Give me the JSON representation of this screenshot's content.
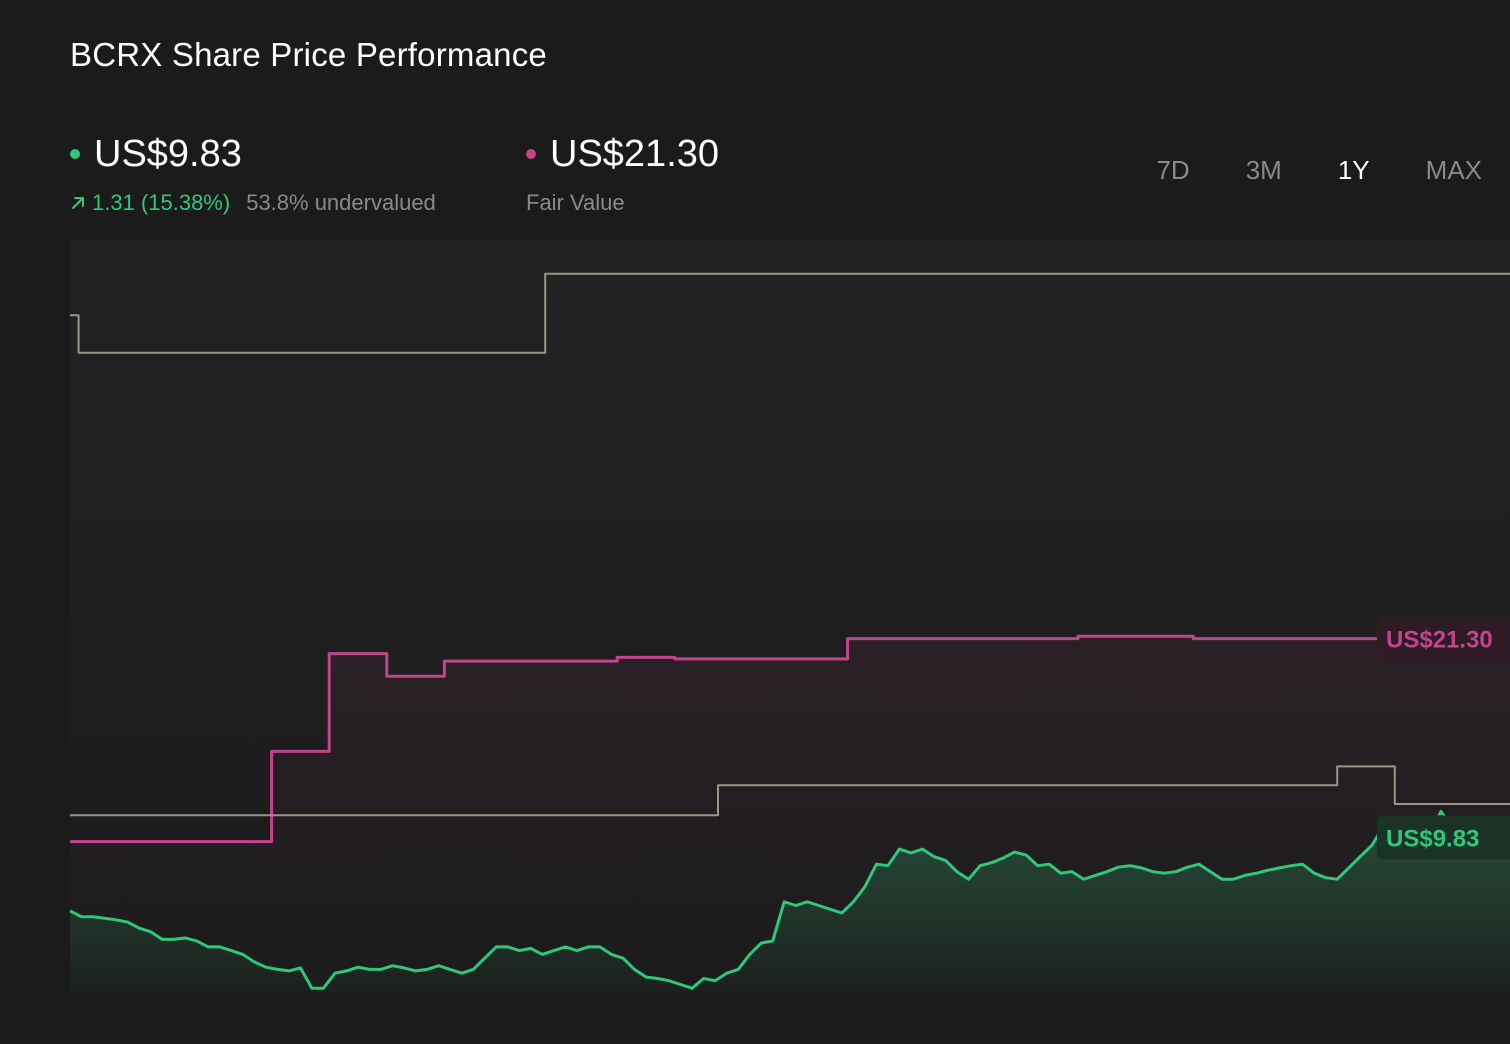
{
  "header": {
    "title": "BCRX Share Price Performance"
  },
  "price": {
    "value": "US$9.83",
    "change": "1.31 (15.38%)",
    "valuation": "53.8% undervalued",
    "color": "#2fc77a"
  },
  "fair_value": {
    "value": "US$21.30",
    "label": "Fair Value",
    "color": "#c2448b"
  },
  "tabs": [
    {
      "label": "7D",
      "active": false
    },
    {
      "label": "3M",
      "active": false
    },
    {
      "label": "1Y",
      "active": true
    },
    {
      "label": "MAX",
      "active": false
    }
  ],
  "icons": {
    "change": "arrow-up-right-icon"
  },
  "chart_data": {
    "type": "line",
    "xlim": [
      0,
      1
    ],
    "ylim": [
      0,
      1
    ],
    "grid": false,
    "series": [
      {
        "name": "",
        "color": "#c2448b",
        "label": "US$21.30",
        "step": true,
        "points": [
          [
            0.0,
            0.2
          ],
          [
            0.14,
            0.2
          ],
          [
            0.14,
            0.32
          ],
          [
            0.18,
            0.32
          ],
          [
            0.18,
            0.45
          ],
          [
            0.22,
            0.45
          ],
          [
            0.22,
            0.42
          ],
          [
            0.26,
            0.42
          ],
          [
            0.26,
            0.44
          ],
          [
            0.38,
            0.44
          ],
          [
            0.38,
            0.445
          ],
          [
            0.42,
            0.445
          ],
          [
            0.42,
            0.443
          ],
          [
            0.54,
            0.443
          ],
          [
            0.54,
            0.47
          ],
          [
            0.7,
            0.47
          ],
          [
            0.7,
            0.473
          ],
          [
            0.78,
            0.473
          ],
          [
            0.78,
            0.47
          ],
          [
            1.0,
            0.47
          ]
        ]
      },
      {
        "name": "",
        "color": "#9a9684",
        "step": true,
        "points": [
          [
            0.0,
            0.9
          ],
          [
            0.006,
            0.9
          ],
          [
            0.006,
            0.85
          ],
          [
            0.33,
            0.85
          ],
          [
            0.33,
            0.955
          ],
          [
            1.0,
            0.955
          ]
        ]
      },
      {
        "name": "",
        "color": "#9a9684",
        "step": true,
        "points": [
          [
            0.0,
            0.235
          ],
          [
            0.45,
            0.235
          ],
          [
            0.45,
            0.275
          ],
          [
            0.88,
            0.275
          ],
          [
            0.88,
            0.3
          ],
          [
            0.92,
            0.3
          ],
          [
            0.92,
            0.25
          ],
          [
            1.0,
            0.25
          ]
        ]
      },
      {
        "name": "",
        "color": "#2fc77a",
        "label": "US$9.83",
        "values": [
          0.108,
          0.1,
          0.1,
          0.098,
          0.096,
          0.093,
          0.085,
          0.08,
          0.07,
          0.07,
          0.072,
          0.068,
          0.06,
          0.06,
          0.055,
          0.05,
          0.04,
          0.033,
          0.03,
          0.028,
          0.032,
          0.005,
          0.005,
          0.025,
          0.028,
          0.033,
          0.03,
          0.03,
          0.035,
          0.032,
          0.028,
          0.03,
          0.035,
          0.03,
          0.025,
          0.03,
          0.045,
          0.06,
          0.06,
          0.055,
          0.058,
          0.05,
          0.055,
          0.06,
          0.055,
          0.06,
          0.06,
          0.05,
          0.045,
          0.03,
          0.02,
          0.018,
          0.015,
          0.01,
          0.005,
          0.018,
          0.015,
          0.025,
          0.03,
          0.05,
          0.065,
          0.068,
          0.12,
          0.115,
          0.12,
          0.115,
          0.11,
          0.105,
          0.12,
          0.14,
          0.17,
          0.168,
          0.19,
          0.185,
          0.19,
          0.18,
          0.175,
          0.16,
          0.15,
          0.168,
          0.172,
          0.178,
          0.186,
          0.182,
          0.168,
          0.17,
          0.158,
          0.16,
          0.15,
          0.155,
          0.16,
          0.166,
          0.168,
          0.165,
          0.16,
          0.158,
          0.16,
          0.166,
          0.17,
          0.16,
          0.15,
          0.15,
          0.155,
          0.158,
          0.162,
          0.165,
          0.168,
          0.17,
          0.158,
          0.152,
          0.15,
          0.165,
          0.18,
          0.195,
          0.22,
          0.21,
          0.2,
          0.195,
          0.21,
          0.24,
          0.22,
          0.19,
          0.185,
          0.19,
          0.2,
          0.195
        ]
      }
    ]
  }
}
